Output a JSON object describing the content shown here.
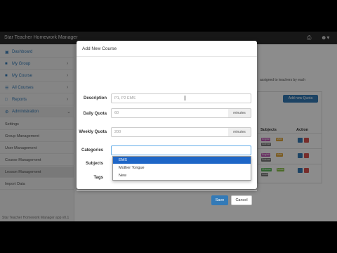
{
  "navbar": {
    "brand": "Star Teacher Homework Manager",
    "icons": [
      "printer-icon",
      "user-icon"
    ]
  },
  "sidebar": {
    "items": [
      {
        "label": "Dashboard",
        "icon": "dashboard-icon"
      },
      {
        "label": "My Group",
        "icon": "bookmark-icon"
      },
      {
        "label": "My Course",
        "icon": "book-icon"
      },
      {
        "label": "All Courses",
        "icon": "list-icon"
      },
      {
        "label": "Reports",
        "icon": "file-icon"
      },
      {
        "label": "Administration",
        "icon": "gear-icon"
      }
    ],
    "subitems": [
      "Settings",
      "Group Management",
      "User Management",
      "Course Management",
      "Lesson Management",
      "Import Data"
    ]
  },
  "main": {
    "info_text": "assigned to teachers by each",
    "add_quota_button": "Add new Quota",
    "table_headers": {
      "subjects": "Subjects",
      "action": "Action"
    },
    "tags": {
      "english": "English",
      "math": "Math",
      "science": "Science",
      "chinese": "Chinese",
      "music": "Music",
      "local": "Local"
    }
  },
  "footer": "Star Teacher Homework Manager app v0.1",
  "modal": {
    "title": "Add New Course",
    "fields": {
      "description": {
        "label": "Description",
        "placeholder": "P1, P2 EMS"
      },
      "daily_quota": {
        "label": "Daily Quota",
        "placeholder": "60",
        "unit": "minutes"
      },
      "weekly_quota": {
        "label": "Weekly Quota",
        "placeholder": "200",
        "unit": "minutes"
      },
      "categories": {
        "label": "Categories",
        "value": "",
        "options": [
          "EMS",
          "Mother Tongue",
          "New"
        ],
        "highlighted": "EMS"
      },
      "subjects": {
        "label": "Subjects"
      },
      "tags": {
        "label": "Tags"
      }
    },
    "save_label": "Save",
    "cancel_label": "Cancel"
  },
  "colors": {
    "primary": "#337ab7",
    "danger": "#d9534f",
    "highlight": "#1e66c7"
  }
}
